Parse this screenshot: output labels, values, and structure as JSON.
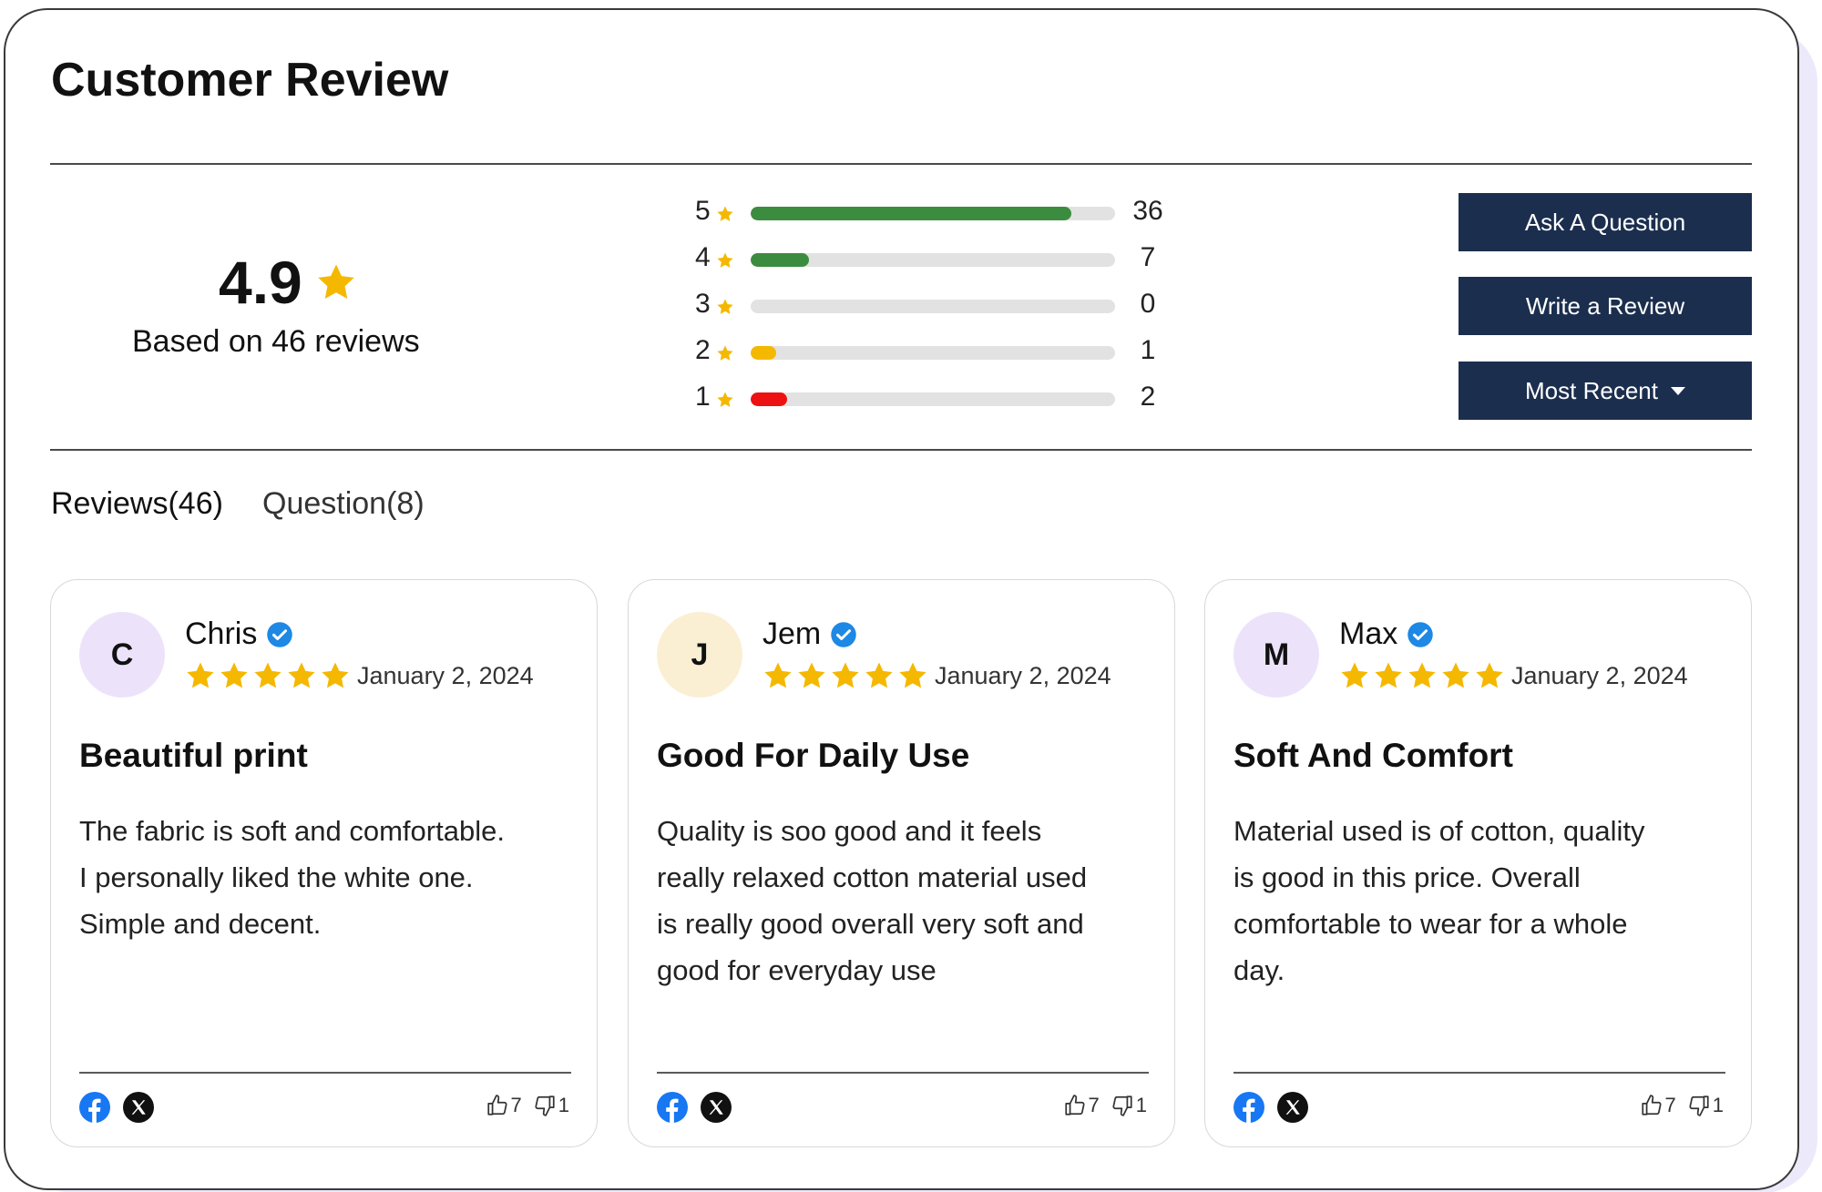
{
  "header": {
    "title": "Customer Review"
  },
  "summary": {
    "average": "4.9",
    "based_on": "Based on 46 reviews"
  },
  "breakdown": [
    {
      "stars": "5",
      "count": "36",
      "fraction": 0.88,
      "color": "#3c8c3f"
    },
    {
      "stars": "4",
      "count": "7",
      "fraction": 0.16,
      "color": "#3c8c3f"
    },
    {
      "stars": "3",
      "count": "0",
      "fraction": 0.0,
      "color": "#3c8c3f"
    },
    {
      "stars": "2",
      "count": "1",
      "fraction": 0.07,
      "color": "#f5b800"
    },
    {
      "stars": "1",
      "count": "2",
      "fraction": 0.1,
      "color": "#ee1111"
    }
  ],
  "actions": {
    "ask_question": "Ask A Question",
    "write_review": "Write a Review",
    "sort": "Most Recent"
  },
  "tabs": {
    "reviews": "Reviews(46)",
    "questions": "Question(8)"
  },
  "colors": {
    "button_bg": "#1b2e4e",
    "star": "#f5b800",
    "verified": "#1e88e5",
    "facebook": "#1877f2"
  },
  "reviews": [
    {
      "initial": "C",
      "avatar_color": "#ece3fb",
      "name": "Chris",
      "date": "January 2, 2024",
      "rating": 5,
      "title": "Beautiful print",
      "body": "The fabric is soft and comfortable. I personally liked the white one. Simple and decent.",
      "likes": "7",
      "dislikes": "1"
    },
    {
      "initial": "J",
      "avatar_color": "#fbefd3",
      "name": "Jem",
      "date": "January 2, 2024",
      "rating": 5,
      "title": "Good For Daily Use",
      "body": "Quality is soo good and it feels really relaxed cotton material used is really good overall very soft and good for everyday use",
      "likes": "7",
      "dislikes": "1"
    },
    {
      "initial": "M",
      "avatar_color": "#ece3fb",
      "name": "Max",
      "date": "January 2, 2024",
      "rating": 5,
      "title": "Soft And Comfort",
      "body": "Material used is of cotton, quality is good in this price. Overall comfortable to wear for a whole day.",
      "likes": "7",
      "dislikes": "1"
    }
  ]
}
